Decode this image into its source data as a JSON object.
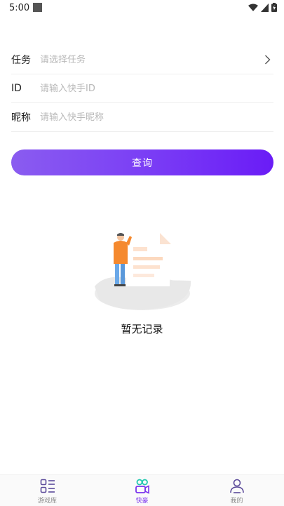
{
  "status_bar": {
    "time": "5:00"
  },
  "form": {
    "task": {
      "label": "任务",
      "placeholder": "请选择任务"
    },
    "id": {
      "label": "ID",
      "placeholder": "请输入快手ID"
    },
    "nickname": {
      "label": "昵称",
      "placeholder": "请输入快手昵称"
    }
  },
  "query_button": {
    "label": "查询"
  },
  "empty_state": {
    "text": "暂无记录"
  },
  "tabs": [
    {
      "label": "游戏库",
      "icon": "list-icon",
      "active": false
    },
    {
      "label": "快豪",
      "icon": "kuaishou-camera-icon",
      "active": true
    },
    {
      "label": "我的",
      "icon": "profile-icon",
      "active": false
    }
  ],
  "colors": {
    "accent": "#7a33ee",
    "button_gradient_start": "#8a5cf0",
    "button_gradient_end": "#6a1cf6",
    "placeholder": "#b8b8b8",
    "divider": "#eeeeee"
  }
}
